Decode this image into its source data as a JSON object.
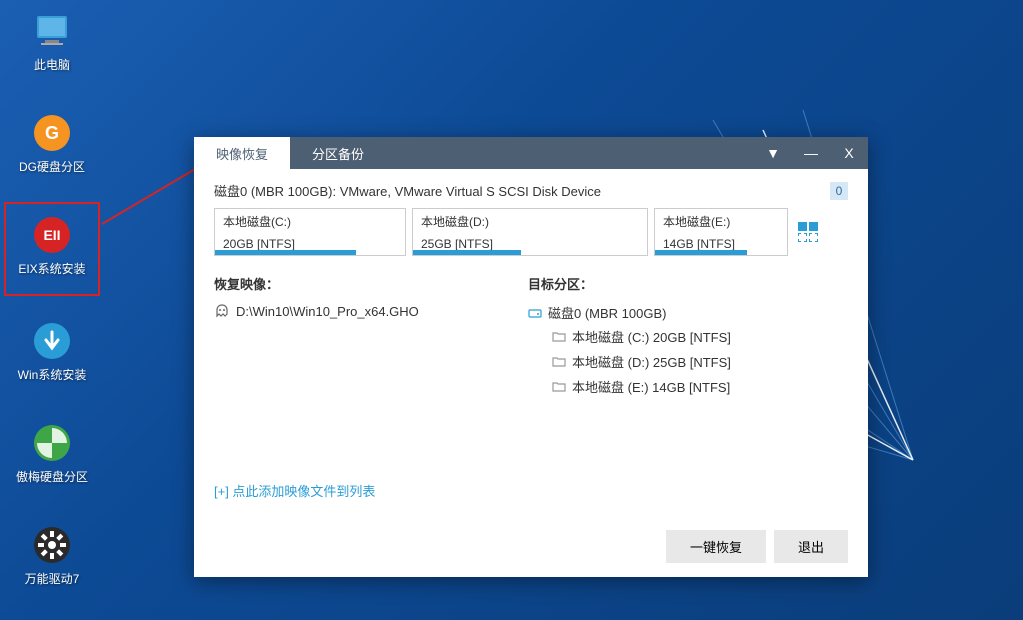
{
  "desktop": {
    "icons": [
      {
        "name": "此电脑",
        "icon": "pc"
      },
      {
        "name": "DG硬盘分区",
        "icon": "dg"
      },
      {
        "name": "EIX系统安装",
        "icon": "eix"
      },
      {
        "name": "Win系统安装",
        "icon": "win"
      },
      {
        "name": "傲梅硬盘分区",
        "icon": "aomei"
      },
      {
        "name": "万能驱动7",
        "icon": "driver"
      }
    ]
  },
  "window": {
    "tabs": {
      "active": "映像恢复",
      "other": "分区备份"
    },
    "disk_title": "磁盘0 (MBR 100GB): VMware, VMware Virtual S SCSI Disk Device",
    "disk_index": "0",
    "partitions": [
      {
        "label": "本地磁盘(C:)",
        "size": "20GB [NTFS]",
        "fillPct": 74,
        "widthPx": 192
      },
      {
        "label": "本地磁盘(D:)",
        "size": "25GB [NTFS]",
        "fillPct": 46,
        "widthPx": 236
      },
      {
        "label": "本地磁盘(E:)",
        "size": "14GB [NTFS]",
        "fillPct": 70,
        "widthPx": 134
      }
    ],
    "left": {
      "heading": "恢复映像：",
      "file": "D:\\Win10\\Win10_Pro_x64.GHO",
      "add_link": "[+] 点此添加映像文件到列表"
    },
    "right": {
      "heading": "目标分区：",
      "root": "磁盘0 (MBR 100GB)",
      "children": [
        "本地磁盘 (C:) 20GB [NTFS]",
        "本地磁盘 (D:) 25GB [NTFS]",
        "本地磁盘 (E:) 14GB [NTFS]"
      ]
    },
    "buttons": {
      "restore": "一键恢复",
      "exit": "退出"
    }
  }
}
